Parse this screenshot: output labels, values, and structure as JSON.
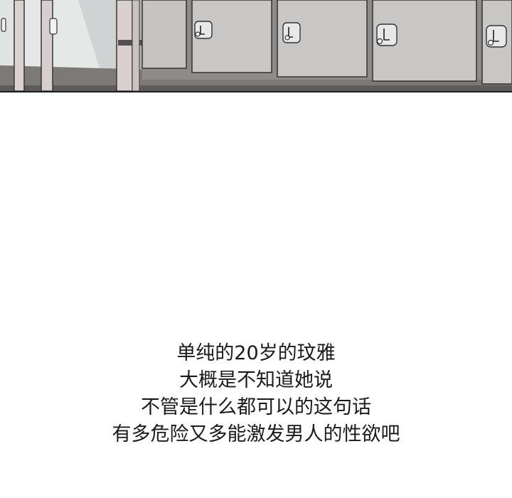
{
  "caption": {
    "lines": [
      "单纯的20岁的玟雅",
      "大概是不知道她说",
      "不管是什么都可以的这句话",
      "有多危险又多能激发男人的性欲吧"
    ]
  },
  "colors": {
    "background": "#ffffff",
    "text": "#1a1a1a",
    "locker": "#c9c7c6",
    "locker_shadow": "#8f8d8c",
    "floor": "#7a7674"
  }
}
